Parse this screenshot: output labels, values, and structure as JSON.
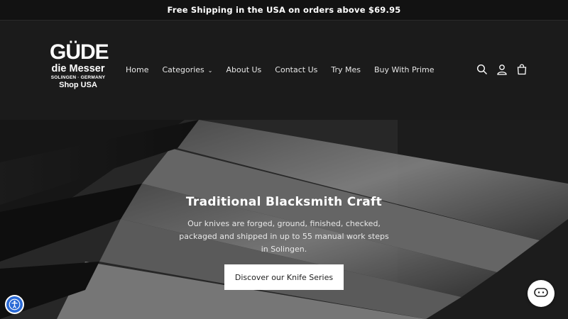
{
  "announcement": "Free Shipping in the USA on orders above $69.95",
  "logo": {
    "mark": "GÜDE",
    "line1": "die Messer",
    "line2": "SOLINGEN · GERMANY",
    "line3": "Shop USA"
  },
  "nav": [
    {
      "label": "Home"
    },
    {
      "label": "Categories"
    },
    {
      "label": "About Us"
    },
    {
      "label": "Contact Us"
    },
    {
      "label": "Try Mes"
    },
    {
      "label": "Buy With Prime"
    }
  ],
  "icons": [
    "search-icon",
    "account-icon",
    "cart-icon",
    "accessibility-icon",
    "chat-icon"
  ],
  "hero": {
    "title": "Traditional Blacksmith Craft",
    "text": "Our knives are forged, ground, finished, checked, packaged and shipped in up to 55 manual work steps in Solingen.",
    "cta": "Discover our Knife Series"
  },
  "colors": {
    "background": "#121212",
    "header": "#1b1b1b",
    "button": "#ffffff",
    "accessibility": "#2a6ad6"
  }
}
